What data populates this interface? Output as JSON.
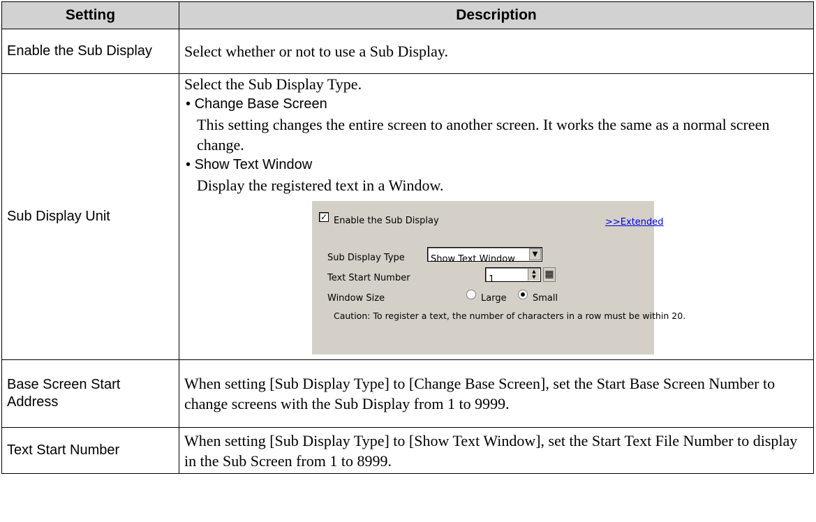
{
  "table": {
    "headers": {
      "setting": "Setting",
      "description": "Description"
    },
    "rows": [
      {
        "setting": "Enable the Sub Display",
        "description": "Select whether or not to use a Sub Display."
      },
      {
        "setting": "Sub Display Unit",
        "intro": "Select the Sub Display Type.",
        "bullets": [
          {
            "title": "Change Base Screen",
            "text": "This setting changes the entire screen to another screen. It works the same as a normal screen change."
          },
          {
            "title": "Show Text Window",
            "text": "Display the registered text in a Window."
          }
        ],
        "dialog": {
          "enable_label": "Enable the Sub Display",
          "enable_checked": true,
          "extended_link": ">>Extended",
          "type_label": "Sub Display Type",
          "type_value": "Show Text Window",
          "text_start_label": "Text Start Number",
          "text_start_value": "1",
          "window_size_label": "Window Size",
          "option_large": "Large",
          "option_small": "Small",
          "selected_option": "Small",
          "caution": "Caution: To register a text, the number of characters in a row must be within 20."
        }
      },
      {
        "setting": "Base Screen Start Address",
        "description": "When setting [Sub Display Type] to [Change Base Screen], set the Start Base Screen Number to change screens with the Sub Display from 1 to 9999."
      },
      {
        "setting": "Text Start Number",
        "description": "When setting [Sub Display Type] to [Show Text Window], set the Start Text File Number to display in the Sub Screen from 1 to 8999."
      }
    ]
  },
  "icons": {
    "checkbox": "check-mark",
    "dropdown": "down-arrow",
    "spinner": "up-down-arrows",
    "device_button": "grid-icon"
  },
  "colors": {
    "header_bg": "#d2d2d2",
    "dialog_bg": "#d4d0c8",
    "link": "#0000ee"
  }
}
